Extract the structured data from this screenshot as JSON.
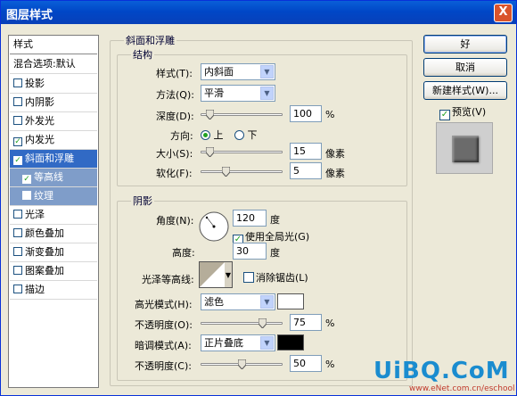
{
  "window": {
    "title": "图层样式",
    "close_glyph": "X"
  },
  "styles": {
    "header": "样式",
    "blend_options": "混合选项:默认",
    "items": [
      {
        "label": "投影",
        "checked": false
      },
      {
        "label": "内阴影",
        "checked": false
      },
      {
        "label": "外发光",
        "checked": false
      },
      {
        "label": "内发光",
        "checked": true
      },
      {
        "label": "斜面和浮雕",
        "checked": true,
        "selected": true
      },
      {
        "label": "等高线",
        "checked": true,
        "sub": true
      },
      {
        "label": "纹理",
        "checked": false,
        "sub": true
      },
      {
        "label": "光泽",
        "checked": false
      },
      {
        "label": "颜色叠加",
        "checked": false
      },
      {
        "label": "渐变叠加",
        "checked": false
      },
      {
        "label": "图案叠加",
        "checked": false
      },
      {
        "label": "描边",
        "checked": false
      }
    ]
  },
  "bevel": {
    "group_title": "斜面和浮雕",
    "structure": {
      "title": "结构",
      "style_label": "样式(T):",
      "style_value": "内斜面",
      "technique_label": "方法(Q):",
      "technique_value": "平滑",
      "depth_label": "深度(D):",
      "depth_value": "100",
      "depth_unit": "%",
      "depth_slider": 0.1,
      "direction_label": "方向:",
      "dir_up": "上",
      "dir_down": "下",
      "size_label": "大小(S):",
      "size_value": "15",
      "size_unit": "像素",
      "size_slider": 0.1,
      "soften_label": "软化(F):",
      "soften_value": "5",
      "soften_unit": "像素",
      "soften_slider": 0.3
    },
    "shading": {
      "title": "阴影",
      "angle_label": "角度(N):",
      "angle_value": "120",
      "angle_unit": "度",
      "global_light_label": "使用全局光(G)",
      "altitude_label": "高度:",
      "altitude_value": "30",
      "altitude_unit": "度",
      "gloss_label": "光泽等高线:",
      "antialias_label": "消除锯齿(L)",
      "highlight_mode_label": "高光模式(H):",
      "highlight_mode_value": "滤色",
      "highlight_color": "#ffffff",
      "highlight_opacity_label": "不透明度(O):",
      "highlight_opacity_value": "75",
      "highlight_opacity_unit": "%",
      "highlight_opacity_slider": 0.75,
      "shadow_mode_label": "暗调模式(A):",
      "shadow_mode_value": "正片叠底",
      "shadow_color": "#000000",
      "shadow_opacity_label": "不透明度(C):",
      "shadow_opacity_value": "50",
      "shadow_opacity_unit": "%",
      "shadow_opacity_slider": 0.5
    }
  },
  "buttons": {
    "ok": "好",
    "cancel": "取消",
    "new_style": "新建样式(W)...",
    "preview": "预览(V)"
  },
  "watermark": {
    "text": "UiBQ.CoM",
    "url": "www.eNet.com.cn/eschool"
  },
  "colors": {
    "accent": "#316ac5",
    "title_bar": "#0047c7"
  }
}
